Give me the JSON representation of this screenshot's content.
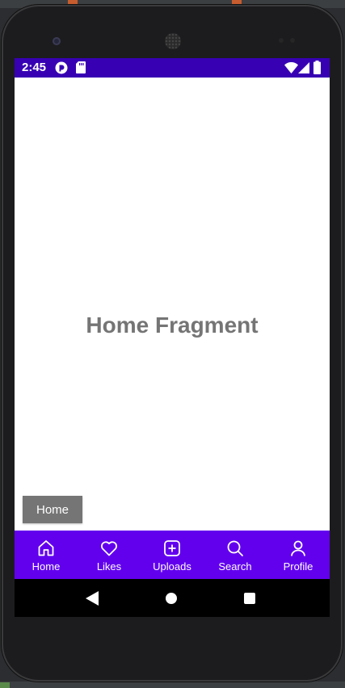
{
  "status_bar": {
    "time": "2:45",
    "background_color": "#3700b3",
    "left_icons": [
      "pocket-casts-icon",
      "sd-card-icon"
    ],
    "right_icons": [
      "wifi-icon",
      "signal-icon",
      "battery-icon"
    ]
  },
  "content": {
    "title": "Home Fragment",
    "button_label": "Home"
  },
  "bottom_nav": {
    "background_color": "#6200ee",
    "items": [
      {
        "label": "Home",
        "icon": "home-icon"
      },
      {
        "label": "Likes",
        "icon": "heart-icon"
      },
      {
        "label": "Uploads",
        "icon": "add-box-icon"
      },
      {
        "label": "Search",
        "icon": "search-icon"
      },
      {
        "label": "Profile",
        "icon": "person-icon"
      }
    ]
  },
  "system_nav": {
    "buttons": [
      "back-icon",
      "home-circle-icon",
      "recents-square-icon"
    ]
  },
  "colors": {
    "title_text": "#757575",
    "button_bg": "#757575"
  }
}
